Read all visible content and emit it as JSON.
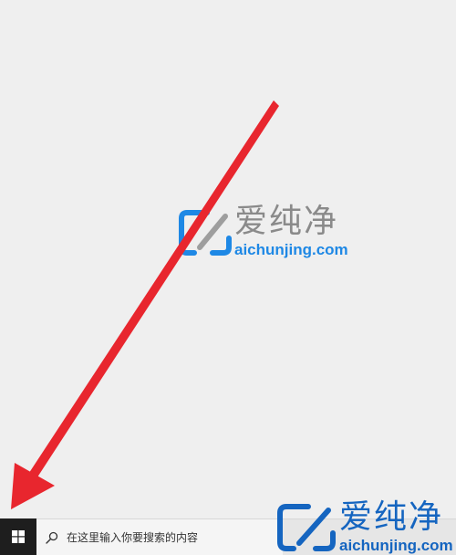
{
  "watermark": {
    "brand_cn": "爱纯净",
    "brand_url": "aichunjing.com",
    "logo_icon": "aichunjing-logo-icon"
  },
  "annotation": {
    "arrow_icon": "red-arrow-icon",
    "arrow_color": "#e8262e"
  },
  "taskbar": {
    "start_icon": "windows-logo-icon",
    "search_icon": "search-icon",
    "search_placeholder": "在这里输入你要搜索的内容"
  },
  "colors": {
    "desktop_bg": "#efefef",
    "taskbar_bg": "#e6e6e6",
    "start_bg": "#1e1e1e",
    "brand_blue": "#1e88e5"
  }
}
